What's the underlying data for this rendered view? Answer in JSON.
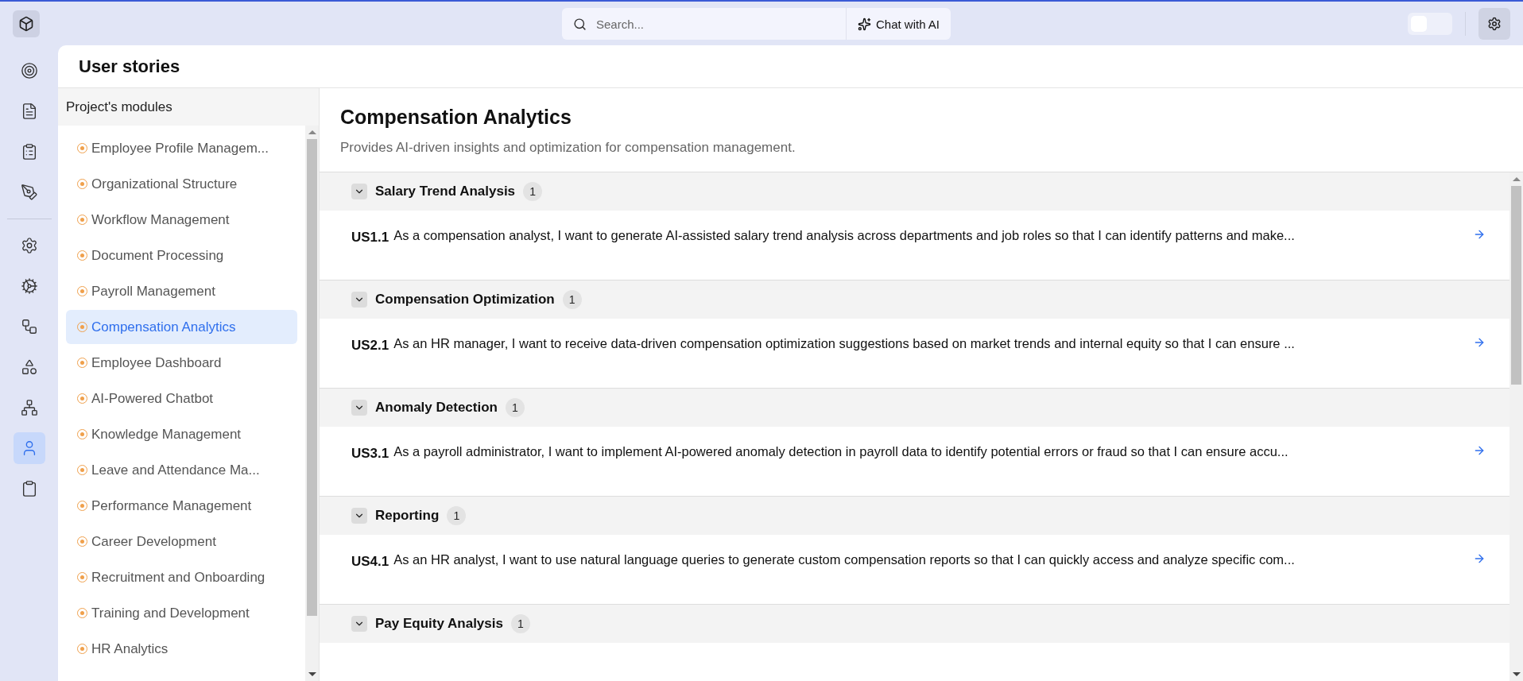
{
  "top_bar": {
    "search": {
      "placeholder": "Search..."
    },
    "chat_button": "Chat with AI",
    "toggle": {
      "on": false
    }
  },
  "rail": {
    "items": [
      {
        "kind": "target",
        "selected": false
      },
      {
        "kind": "document",
        "selected": false
      },
      {
        "kind": "clipboard-list",
        "selected": false
      },
      {
        "kind": "pen",
        "selected": false
      },
      {
        "kind": "divider"
      },
      {
        "kind": "gear",
        "selected": false
      },
      {
        "kind": "cog",
        "selected": false
      },
      {
        "kind": "workflow",
        "selected": false
      },
      {
        "kind": "shapes",
        "selected": false
      },
      {
        "kind": "network",
        "selected": false
      },
      {
        "kind": "user",
        "selected": true
      },
      {
        "kind": "clipboard",
        "selected": false
      }
    ]
  },
  "page_title": "User stories",
  "modules": {
    "title": "Project's modules",
    "items": [
      {
        "label": "Employee Profile Managem...",
        "selected": false
      },
      {
        "label": "Organizational Structure",
        "selected": false
      },
      {
        "label": "Workflow Management",
        "selected": false
      },
      {
        "label": "Document Processing",
        "selected": false
      },
      {
        "label": "Payroll Management",
        "selected": false
      },
      {
        "label": "Compensation Analytics",
        "selected": true
      },
      {
        "label": "Employee Dashboard",
        "selected": false
      },
      {
        "label": "AI-Powered Chatbot",
        "selected": false
      },
      {
        "label": "Knowledge Management",
        "selected": false
      },
      {
        "label": "Leave and Attendance Ma...",
        "selected": false
      },
      {
        "label": "Performance Management",
        "selected": false
      },
      {
        "label": "Career Development",
        "selected": false
      },
      {
        "label": "Recruitment and Onboarding",
        "selected": false
      },
      {
        "label": "Training and Development",
        "selected": false
      },
      {
        "label": "HR Analytics",
        "selected": false
      }
    ]
  },
  "module": {
    "title": "Compensation Analytics",
    "description": "Provides AI-driven insights and optimization for compensation management.",
    "sections": [
      {
        "title": "Salary Trend Analysis",
        "count": "1",
        "expanded": true,
        "stories": [
          {
            "id": "US1.1",
            "text": "As a compensation analyst, I want to generate AI-assisted salary trend analysis across departments and job roles so that I can identify patterns and make..."
          }
        ]
      },
      {
        "title": "Compensation Optimization",
        "count": "1",
        "expanded": true,
        "stories": [
          {
            "id": "US2.1",
            "text": "As an HR manager, I want to receive data-driven compensation optimization suggestions based on market trends and internal equity so that I can ensure ..."
          }
        ]
      },
      {
        "title": "Anomaly Detection",
        "count": "1",
        "expanded": true,
        "stories": [
          {
            "id": "US3.1",
            "text": "As a payroll administrator, I want to implement AI-powered anomaly detection in payroll data to identify potential errors or fraud so that I can ensure accu..."
          }
        ]
      },
      {
        "title": "Reporting",
        "count": "1",
        "expanded": true,
        "stories": [
          {
            "id": "US4.1",
            "text": "As an HR analyst, I want to use natural language queries to generate custom compensation reports so that I can quickly access and analyze specific com..."
          }
        ]
      },
      {
        "title": "Pay Equity Analysis",
        "count": "1",
        "expanded": true
      }
    ]
  }
}
